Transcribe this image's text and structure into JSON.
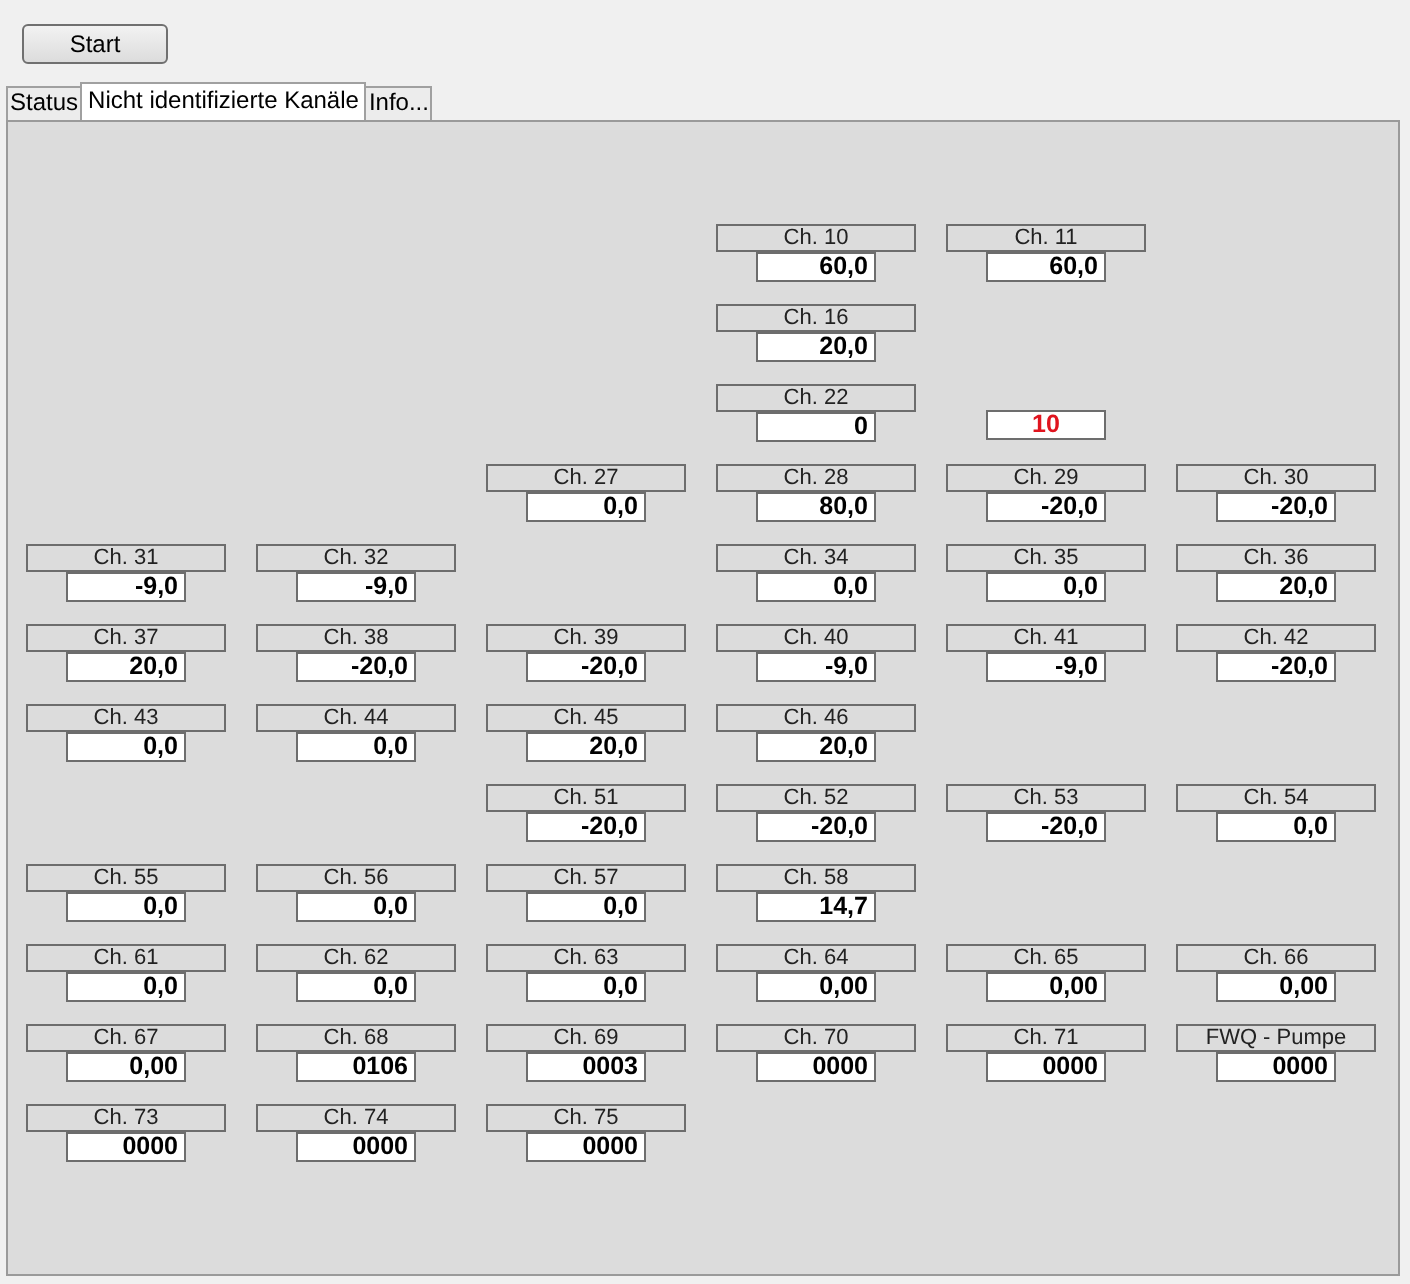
{
  "start_button": {
    "label": "Start"
  },
  "tabs": [
    {
      "label": "Status",
      "selected": false
    },
    {
      "label": "Nicht identifizierte Kanäle",
      "selected": true
    },
    {
      "label": "Info...",
      "selected": false
    }
  ],
  "grid": {
    "rows": [
      {
        "cells": [
          {
            "kind": "empty"
          },
          {
            "kind": "empty"
          },
          {
            "kind": "empty"
          },
          {
            "kind": "channel",
            "name": "Ch. 10",
            "value": "60,0"
          },
          {
            "kind": "channel",
            "name": "Ch. 11",
            "value": "60,0"
          },
          {
            "kind": "empty"
          }
        ]
      },
      {
        "cells": [
          {
            "kind": "empty"
          },
          {
            "kind": "empty"
          },
          {
            "kind": "empty"
          },
          {
            "kind": "channel",
            "name": "Ch. 16",
            "value": "20,0"
          },
          {
            "kind": "empty"
          },
          {
            "kind": "empty"
          }
        ]
      },
      {
        "cells": [
          {
            "kind": "empty"
          },
          {
            "kind": "empty"
          },
          {
            "kind": "empty"
          },
          {
            "kind": "channel",
            "name": "Ch. 22",
            "value": "0"
          },
          {
            "kind": "alert",
            "value": "10"
          },
          {
            "kind": "empty"
          }
        ]
      },
      {
        "cells": [
          {
            "kind": "empty"
          },
          {
            "kind": "empty"
          },
          {
            "kind": "channel",
            "name": "Ch. 27",
            "value": "0,0"
          },
          {
            "kind": "channel",
            "name": "Ch. 28",
            "value": "80,0"
          },
          {
            "kind": "channel",
            "name": "Ch. 29",
            "value": "-20,0"
          },
          {
            "kind": "channel",
            "name": "Ch. 30",
            "value": "-20,0"
          }
        ]
      },
      {
        "cells": [
          {
            "kind": "channel",
            "name": "Ch. 31",
            "value": "-9,0"
          },
          {
            "kind": "channel",
            "name": "Ch. 32",
            "value": "-9,0"
          },
          {
            "kind": "empty"
          },
          {
            "kind": "channel",
            "name": "Ch. 34",
            "value": "0,0"
          },
          {
            "kind": "channel",
            "name": "Ch. 35",
            "value": "0,0"
          },
          {
            "kind": "channel",
            "name": "Ch. 36",
            "value": "20,0"
          }
        ]
      },
      {
        "cells": [
          {
            "kind": "channel",
            "name": "Ch. 37",
            "value": "20,0"
          },
          {
            "kind": "channel",
            "name": "Ch. 38",
            "value": "-20,0"
          },
          {
            "kind": "channel",
            "name": "Ch. 39",
            "value": "-20,0"
          },
          {
            "kind": "channel",
            "name": "Ch. 40",
            "value": "-9,0"
          },
          {
            "kind": "channel",
            "name": "Ch. 41",
            "value": "-9,0"
          },
          {
            "kind": "channel",
            "name": "Ch. 42",
            "value": "-20,0"
          }
        ]
      },
      {
        "cells": [
          {
            "kind": "channel",
            "name": "Ch. 43",
            "value": "0,0"
          },
          {
            "kind": "channel",
            "name": "Ch. 44",
            "value": "0,0"
          },
          {
            "kind": "channel",
            "name": "Ch. 45",
            "value": "20,0"
          },
          {
            "kind": "channel",
            "name": "Ch. 46",
            "value": "20,0"
          },
          {
            "kind": "empty"
          },
          {
            "kind": "empty"
          }
        ]
      },
      {
        "cells": [
          {
            "kind": "empty"
          },
          {
            "kind": "empty"
          },
          {
            "kind": "channel",
            "name": "Ch. 51",
            "value": "-20,0"
          },
          {
            "kind": "channel",
            "name": "Ch. 52",
            "value": "-20,0"
          },
          {
            "kind": "channel",
            "name": "Ch. 53",
            "value": "-20,0"
          },
          {
            "kind": "channel",
            "name": "Ch. 54",
            "value": "0,0"
          }
        ]
      },
      {
        "cells": [
          {
            "kind": "channel",
            "name": "Ch. 55",
            "value": "0,0"
          },
          {
            "kind": "channel",
            "name": "Ch. 56",
            "value": "0,0"
          },
          {
            "kind": "channel",
            "name": "Ch. 57",
            "value": "0,0"
          },
          {
            "kind": "channel",
            "name": "Ch. 58",
            "value": "14,7"
          },
          {
            "kind": "empty"
          },
          {
            "kind": "empty"
          }
        ]
      },
      {
        "cells": [
          {
            "kind": "channel",
            "name": "Ch. 61",
            "value": "0,0"
          },
          {
            "kind": "channel",
            "name": "Ch. 62",
            "value": "0,0"
          },
          {
            "kind": "channel",
            "name": "Ch. 63",
            "value": "0,0"
          },
          {
            "kind": "channel",
            "name": "Ch. 64",
            "value": "0,00"
          },
          {
            "kind": "channel",
            "name": "Ch. 65",
            "value": "0,00"
          },
          {
            "kind": "channel",
            "name": "Ch. 66",
            "value": "0,00"
          }
        ]
      },
      {
        "cells": [
          {
            "kind": "channel",
            "name": "Ch. 67",
            "value": "0,00"
          },
          {
            "kind": "channel",
            "name": "Ch. 68",
            "value": "0106"
          },
          {
            "kind": "channel",
            "name": "Ch. 69",
            "value": "0003"
          },
          {
            "kind": "channel",
            "name": "Ch. 70",
            "value": "0000"
          },
          {
            "kind": "channel",
            "name": "Ch. 71",
            "value": "0000"
          },
          {
            "kind": "channel",
            "name": "FWQ - Pumpe",
            "value": "0000"
          }
        ]
      },
      {
        "cells": [
          {
            "kind": "channel",
            "name": "Ch. 73",
            "value": "0000"
          },
          {
            "kind": "channel",
            "name": "Ch. 74",
            "value": "0000"
          },
          {
            "kind": "channel",
            "name": "Ch. 75",
            "value": "0000"
          },
          {
            "kind": "empty"
          },
          {
            "kind": "empty"
          },
          {
            "kind": "empty"
          }
        ]
      }
    ]
  }
}
